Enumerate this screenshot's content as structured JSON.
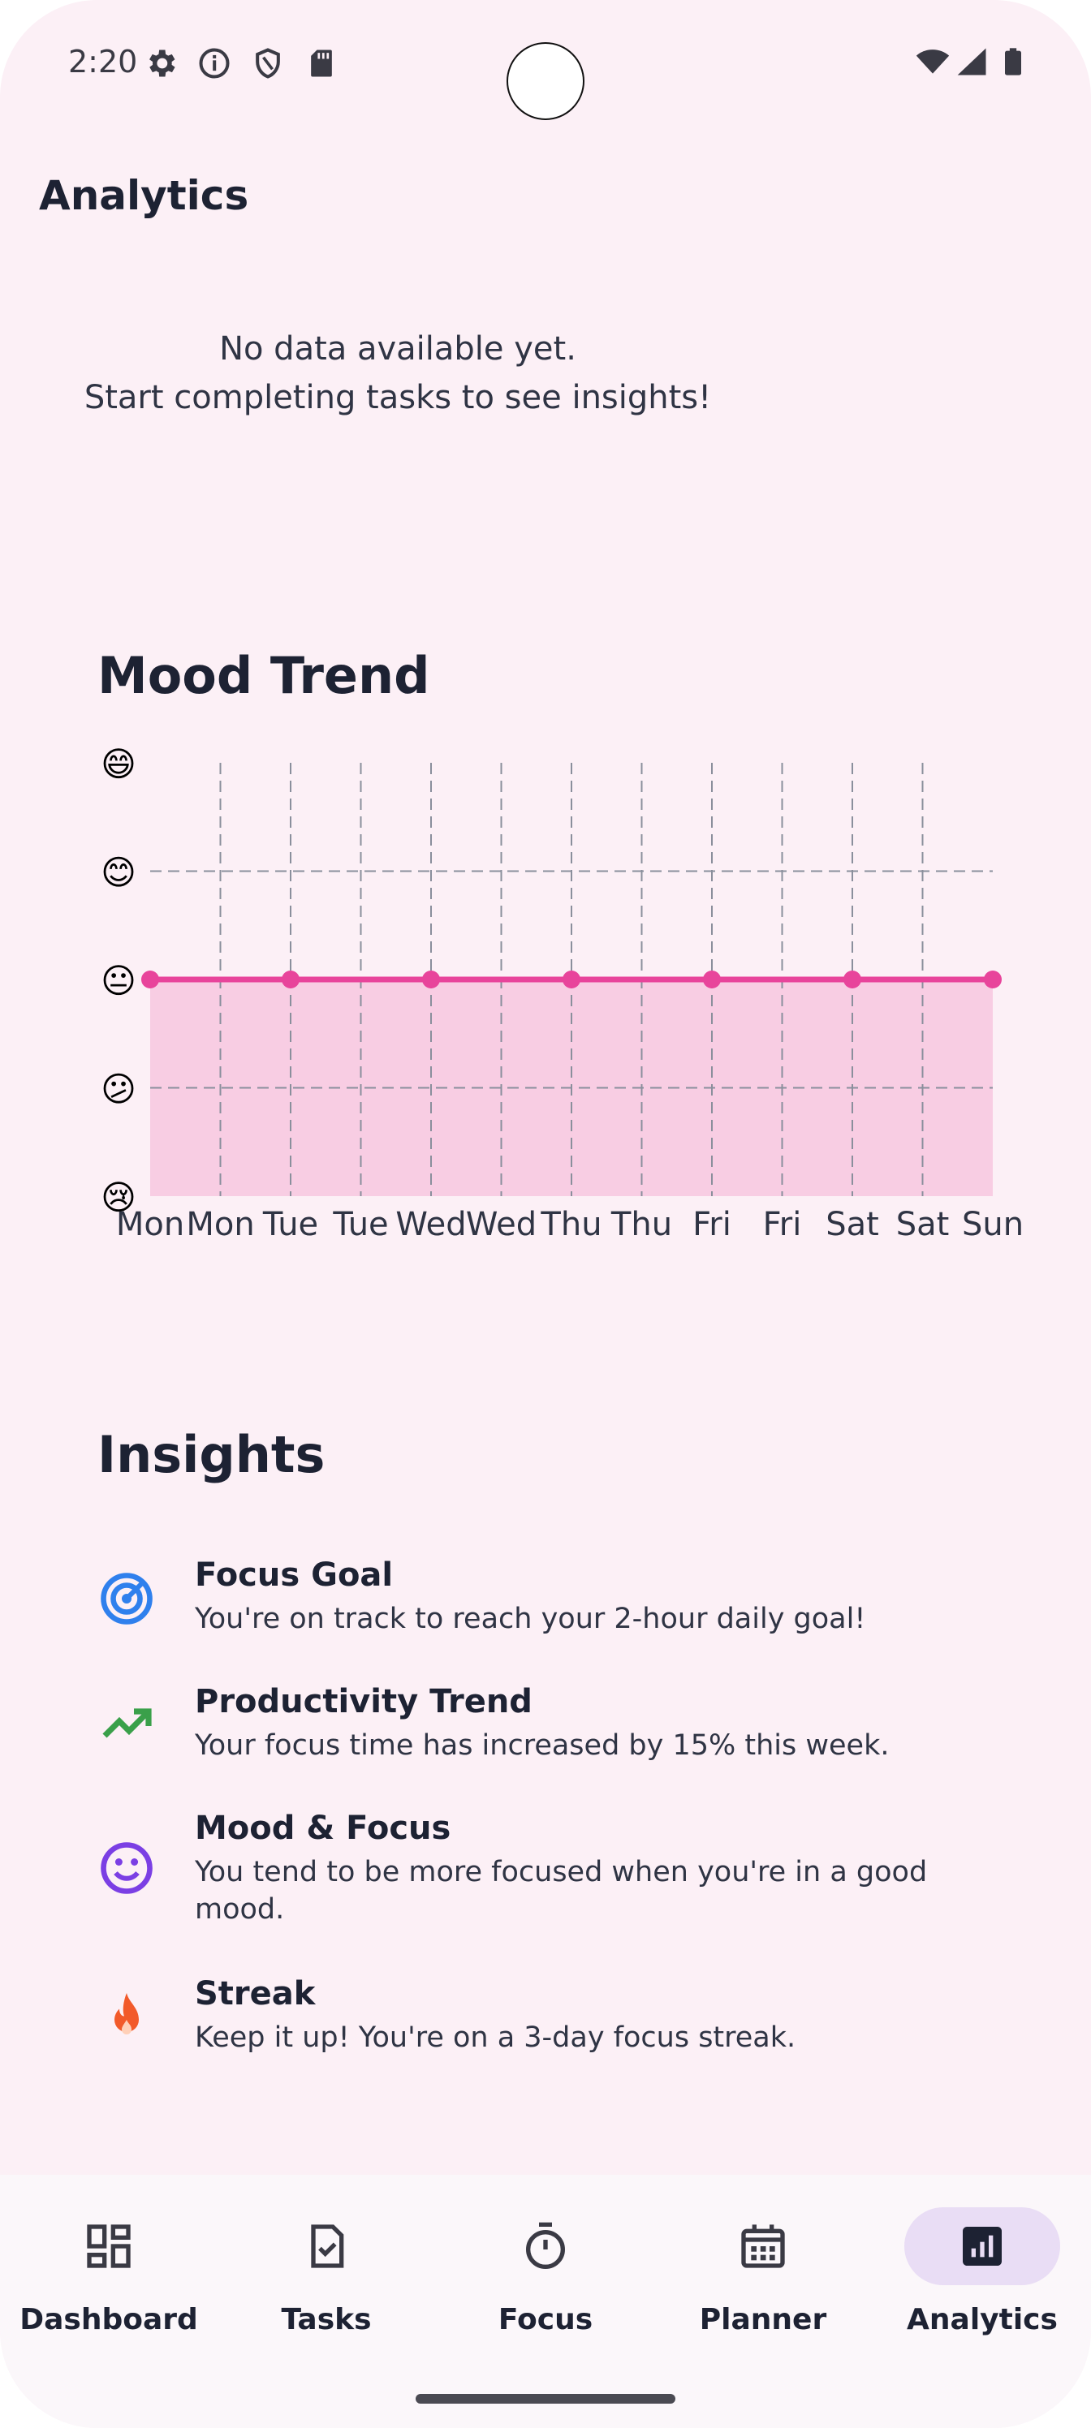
{
  "status_bar": {
    "time": "2:20",
    "left_icons": [
      "gear-icon",
      "info-icon",
      "shield-icon",
      "sd-card-icon"
    ],
    "right_icons": [
      "wifi-icon",
      "signal-icon",
      "battery-icon"
    ]
  },
  "header": {
    "title": "Analytics"
  },
  "empty_state": {
    "line1": "No data available yet.",
    "line2": "Start completing tasks to see insights!"
  },
  "mood_trend": {
    "title": "Mood Trend",
    "y_emojis": [
      "😄",
      "😊",
      "😐",
      "😕",
      "😢"
    ]
  },
  "chart_data": {
    "type": "area",
    "title": "Mood Trend",
    "categories": [
      "Mon",
      "Mon",
      "Tue",
      "Tue",
      "Wed",
      "Wed",
      "Thu",
      "Thu",
      "Fri",
      "Fri",
      "Sat",
      "Sat",
      "Sun"
    ],
    "points": [
      {
        "x": 0,
        "y": 3
      },
      {
        "x": 2,
        "y": 3
      },
      {
        "x": 4,
        "y": 3
      },
      {
        "x": 6,
        "y": 3
      },
      {
        "x": 8,
        "y": 3
      },
      {
        "x": 10,
        "y": 3
      },
      {
        "x": 12,
        "y": 3
      }
    ],
    "ylim": [
      1,
      5
    ],
    "y_tick_labels": [
      "😢",
      "😕",
      "😐",
      "😊",
      "😄"
    ],
    "grid": true,
    "line_color": "#e8449b",
    "fill_color": "#f8cde3"
  },
  "insights": {
    "title": "Insights",
    "items": [
      {
        "icon": "target-icon",
        "color": "#2f80ed",
        "title": "Focus Goal",
        "text": "You're on track to reach your 2-hour daily goal!"
      },
      {
        "icon": "trending-up-icon",
        "color": "#3aa04a",
        "title": "Productivity Trend",
        "text": "Your focus time has increased by 15% this week."
      },
      {
        "icon": "smiley-icon",
        "color": "#7b3fe4",
        "title": "Mood & Focus",
        "text": "You tend to be more focused when you're in a good mood."
      },
      {
        "icon": "flame-icon",
        "color": "#f25a2a",
        "title": "Streak",
        "text": "Keep it up! You're on a 3-day focus streak."
      }
    ]
  },
  "bottom_nav": {
    "items": [
      {
        "label": "Dashboard",
        "icon": "dashboard-icon",
        "active": false
      },
      {
        "label": "Tasks",
        "icon": "task-check-icon",
        "active": false
      },
      {
        "label": "Focus",
        "icon": "timer-icon",
        "active": false
      },
      {
        "label": "Planner",
        "icon": "calendar-icon",
        "active": false
      },
      {
        "label": "Analytics",
        "icon": "analytics-icon",
        "active": true
      }
    ]
  }
}
